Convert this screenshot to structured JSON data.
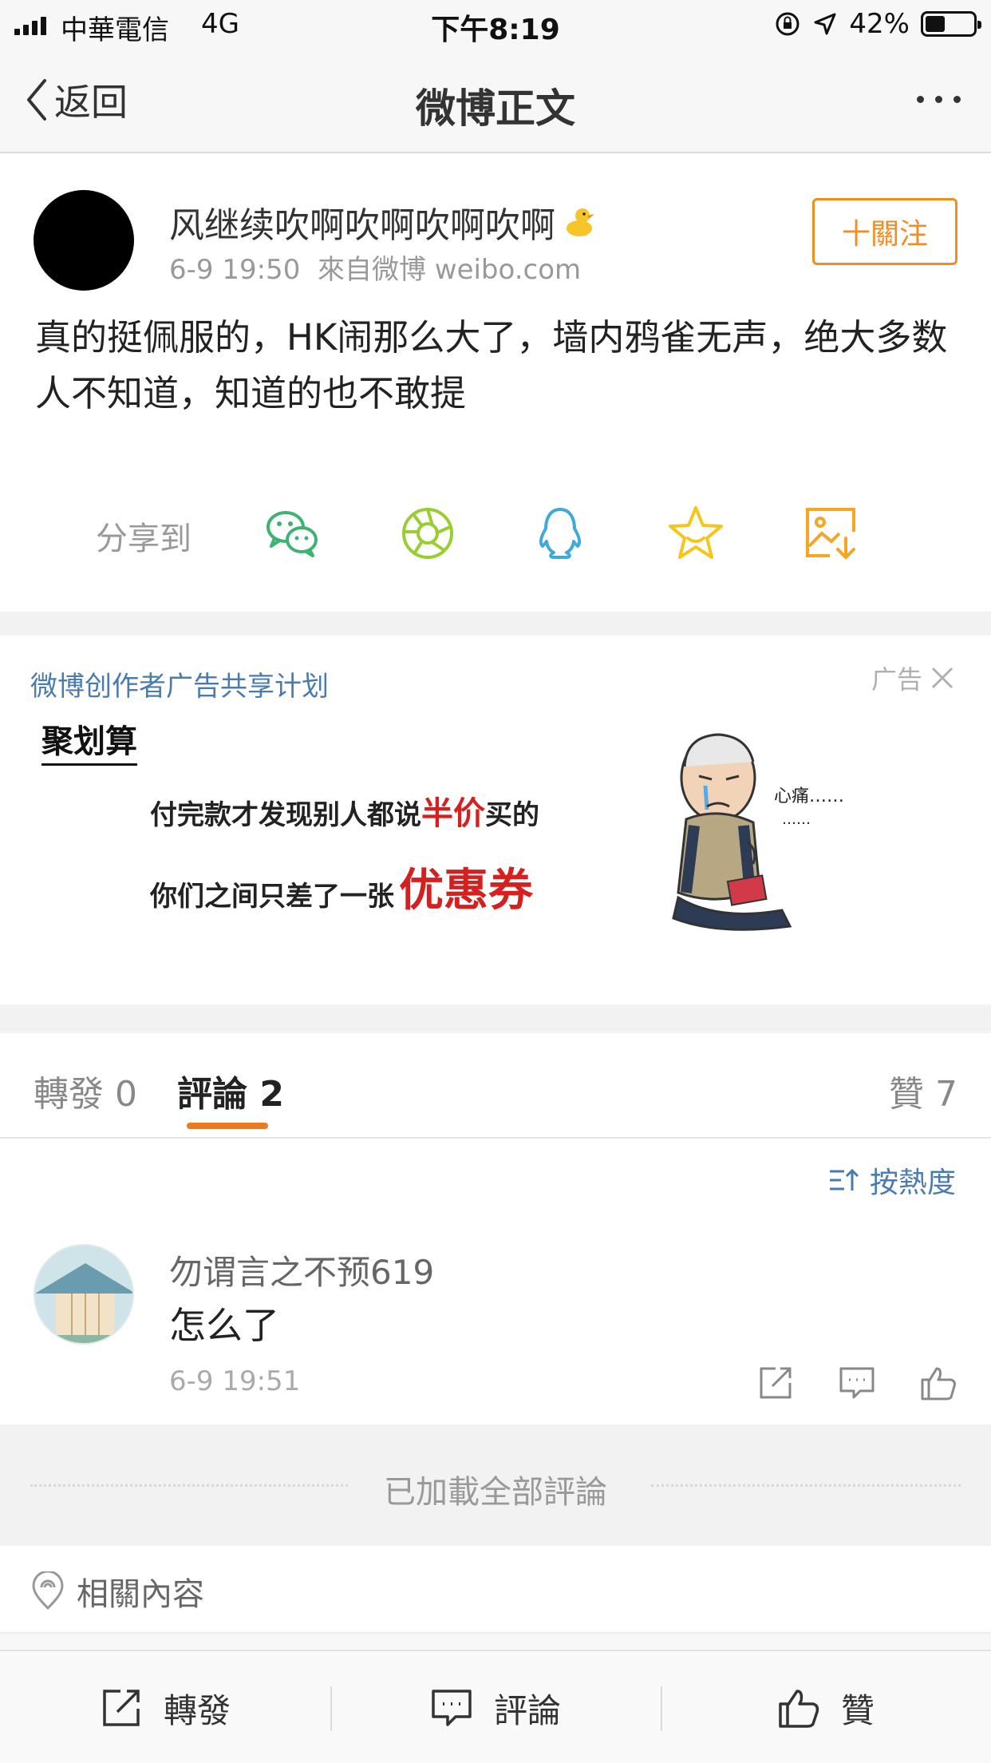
{
  "status_bar": {
    "carrier": "中華電信",
    "network": "4G",
    "time": "下午8:19",
    "battery": "42%",
    "battery_level": 0.42
  },
  "nav": {
    "back_label": "返回",
    "title": "微博正文"
  },
  "post": {
    "author": "风继续吹啊吹啊吹啊吹啊",
    "time": "6-9 19:50",
    "source": "來自微博 weibo.com",
    "follow_label": "十關注",
    "text": "真的挺佩服的，HK闹那么大了，墙内鸦雀无声，绝大多数人不知道，知道的也不敢提",
    "share_label": "分享到",
    "share_icons": [
      "wechat-icon",
      "moments-icon",
      "qq-icon",
      "favorite-star-icon",
      "save-image-icon"
    ]
  },
  "ad": {
    "plan_label": "微博创作者广告共享计划",
    "tag": "广告",
    "brand": "聚划算",
    "line1_pre": "付完款才发现别人都说",
    "line1_highlight": "半价",
    "line1_post": "买的",
    "line2_pre": "你们之间只差了一张",
    "line2_highlight": "优惠券",
    "illus_caption_1": "心痛……",
    "illus_caption_2": "……"
  },
  "tabs": {
    "repost_label": "轉發",
    "repost_count": "0",
    "comment_label": "評論",
    "comment_count": "2",
    "like_label": "贊",
    "like_count": "7"
  },
  "sort_label": "按熱度",
  "comments": [
    {
      "name": "勿谓言之不预619",
      "text": "怎么了",
      "time": "6-9 19:51"
    }
  ],
  "loaded_all": "已加載全部評論",
  "related": "相關內容",
  "toolbar": {
    "repost": "轉發",
    "comment": "評論",
    "like": "贊"
  },
  "colors": {
    "accent_orange": "#f28d24",
    "link_blue": "#4a7bb0",
    "wechat_green": "#3cb371",
    "moments_green": "#9acd32",
    "qq_blue": "#3fa9d8",
    "star_yellow": "#f5c518",
    "save_orange": "#f5a623"
  }
}
